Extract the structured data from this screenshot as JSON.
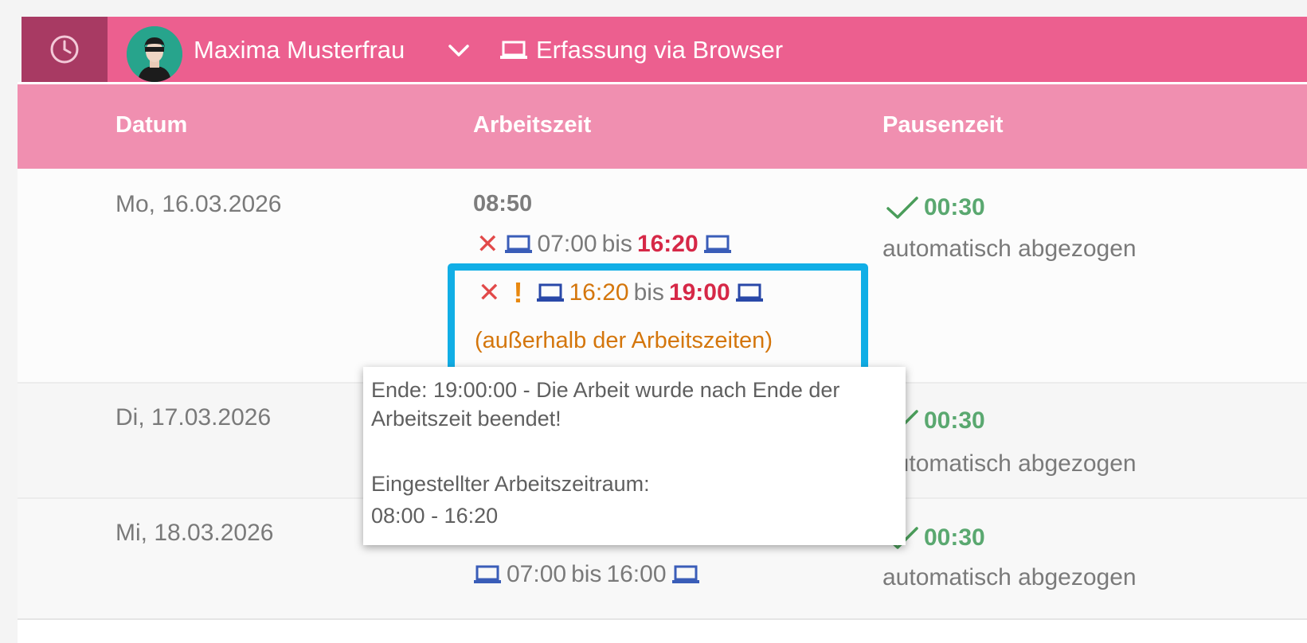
{
  "header": {
    "user_name": "Maxima Musterfrau",
    "capture_mode": "Erfassung via Browser"
  },
  "table": {
    "columns": [
      "Datum",
      "Arbeitszeit",
      "Pausenzeit"
    ],
    "rows": [
      {
        "date": "Mo, 16.03.2026",
        "work_total": "08:50",
        "entries": [
          {
            "start": "07:00",
            "sep": "bis",
            "end": "16:20"
          },
          {
            "start": "16:20",
            "sep": "bis",
            "end": "19:00",
            "note": "(außerhalb der Arbeitszeiten)"
          }
        ],
        "pause": "00:30",
        "pause_note": "automatisch abgezogen"
      },
      {
        "date": "Di, 17.03.2026",
        "pause": "00:30",
        "pause_note": "automatisch abgezogen"
      },
      {
        "date": "Mi, 18.03.2026",
        "entries": [
          {
            "start": "07:00",
            "sep": "bis",
            "end": "16:00"
          }
        ],
        "pause": "00:30",
        "pause_note": "automatisch abgezogen"
      }
    ]
  },
  "tooltip": {
    "line1": "Ende: 19:00:00 - Die Arbeit wurde nach Ende der",
    "line2": "Arbeitszeit beendet!",
    "line3": "Eingestellter Arbeitszeitraum:",
    "line4": "08:00 - 16:20"
  },
  "colors": {
    "header_bar": "#ec5f8f",
    "clock_tab": "#a83a63",
    "table_header": "#f08fb0",
    "highlight": "#11aee6",
    "error": "#e24a4a",
    "warning": "#e8880f",
    "ok": "#4a9d5a",
    "device_icon": "#3a5db8"
  },
  "icons": [
    "clock-icon",
    "avatar-icon",
    "chevron-down-icon",
    "laptop-icon",
    "close-icon",
    "exclamation-icon",
    "check-icon"
  ]
}
